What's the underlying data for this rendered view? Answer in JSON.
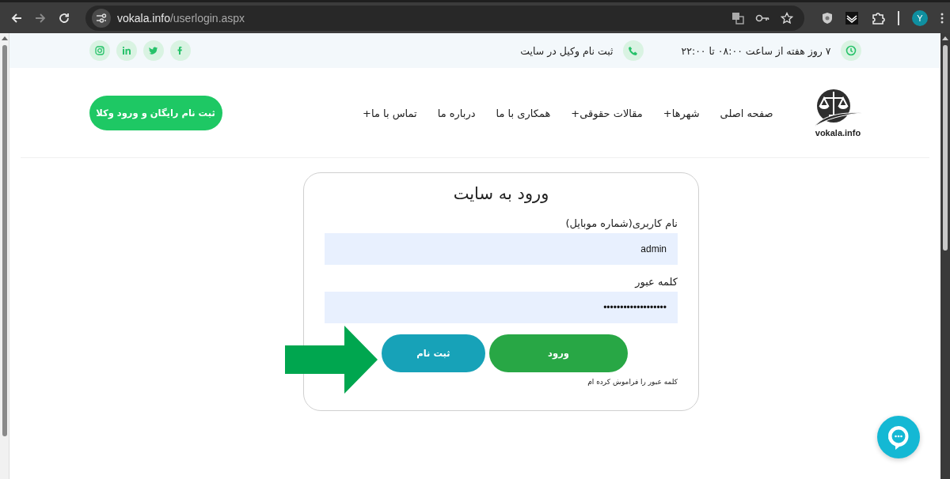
{
  "browser": {
    "url_host": "vokala.info",
    "url_path": "/userlogin.aspx",
    "forward_disabled": true,
    "profile_initial": "Y"
  },
  "topbar": {
    "hours": "۷ روز هفته از ساعت ۰۸:۰۰ تا ۲۲:۰۰",
    "register_lawyer": "ثبت نام وکیل در سایت",
    "social": [
      {
        "kind": "facebook"
      },
      {
        "kind": "twitter"
      },
      {
        "kind": "linkedin"
      },
      {
        "kind": "instagram"
      }
    ]
  },
  "header": {
    "logo_text": "vokala.info",
    "nav": [
      {
        "label": "صفحه اصلی"
      },
      {
        "label": "شهرها+"
      },
      {
        "label": "مقالات حقوقی+"
      },
      {
        "label": "همکاری با ما"
      },
      {
        "label": "درباره ما"
      },
      {
        "label": "تماس با ما+"
      }
    ],
    "cta": "ثبت نام رایگان و ورود وکلا"
  },
  "login": {
    "title": "ورود به سایت",
    "username_label": "نام کاربری(شماره موبایل)",
    "username_value": "admin",
    "password_label": "کلمه عبور",
    "password_value": "•••••••••••••••••••",
    "login_button": "ورود",
    "register_button": "ثبت نام",
    "forgot_link": "کلمه عبور را فراموش کرده ام"
  }
}
